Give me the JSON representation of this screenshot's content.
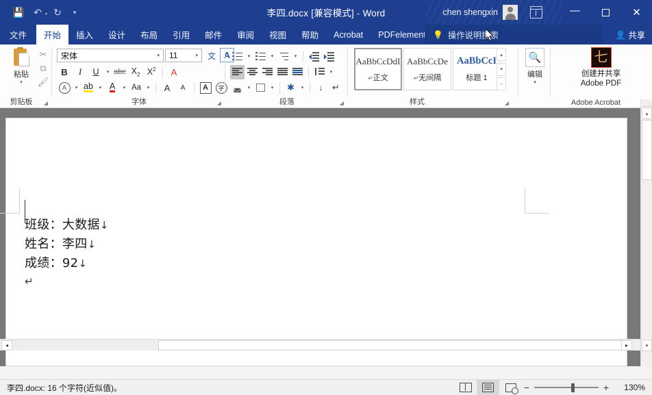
{
  "titlebar": {
    "quick_access": [
      {
        "name": "save-icon",
        "glyph": "💾"
      },
      {
        "name": "undo-icon",
        "glyph": "↶"
      },
      {
        "name": "redo-icon",
        "glyph": "↻"
      },
      {
        "name": "customize-qat-icon",
        "glyph": "▾"
      }
    ],
    "document_name": "李四.docx [兼容模式]",
    "separator": " - ",
    "app_name": "Word",
    "account_name": "chen shengxin",
    "window_buttons": {
      "minimize": "—",
      "maximize": "□",
      "close": "✕"
    }
  },
  "tabs": [
    {
      "label": "文件",
      "active": false
    },
    {
      "label": "开始",
      "active": true
    },
    {
      "label": "插入",
      "active": false
    },
    {
      "label": "设计",
      "active": false
    },
    {
      "label": "布局",
      "active": false
    },
    {
      "label": "引用",
      "active": false
    },
    {
      "label": "邮件",
      "active": false
    },
    {
      "label": "审阅",
      "active": false
    },
    {
      "label": "视图",
      "active": false
    },
    {
      "label": "帮助",
      "active": false
    },
    {
      "label": "Acrobat",
      "active": false
    },
    {
      "label": "PDFelement",
      "active": false
    }
  ],
  "tellme": {
    "label": "操作说明搜索",
    "icon": "lightbulb-icon"
  },
  "share": {
    "label": "共享",
    "icon": "share-person-icon"
  },
  "ribbon": {
    "clipboard": {
      "group_label": "剪贴板",
      "paste_label": "粘贴",
      "paste_caret": "▾",
      "cut": "✂",
      "copy": "⧉",
      "format_painter": "🖌"
    },
    "font": {
      "group_label": "字体",
      "font_name": "宋体",
      "font_size": "11",
      "caret": "▾",
      "bold": "B",
      "italic": "I",
      "underline": "U",
      "strikethrough": "abc",
      "subscript_base": "X",
      "subscript_sub": "2",
      "superscript_base": "X",
      "superscript_sup": "2",
      "clear_format": "A",
      "text_effects": "A",
      "highlight": "ab",
      "font_color": "A",
      "change_case": "Aa",
      "grow_font": "A",
      "shrink_font": "A",
      "char_border": "A",
      "phonetic": "字",
      "asian_layout": "文"
    },
    "paragraph": {
      "group_label": "段落",
      "bullets": "bullet-list-icon",
      "numbering": "numbered-list-icon",
      "multilevel": "multilevel-list-icon",
      "decrease_indent": "decrease-indent-icon",
      "increase_indent": "increase-indent-icon",
      "align_left": "align-left-icon",
      "align_center": "align-center-icon",
      "align_right": "align-right-icon",
      "justify": "justify-icon",
      "distribute": "distribute-icon",
      "line_spacing": "line-spacing-icon",
      "shading": "shading-icon",
      "borders": "borders-icon",
      "phonetic_guide": "phonetic-guide-icon",
      "sort": "sort-icon",
      "show_marks": "show-paragraph-marks-icon"
    },
    "styles": {
      "group_label": "样式",
      "items": [
        {
          "preview": "AaBbCcDdI",
          "name": "正文",
          "pilcrow": "↵",
          "selected": true,
          "blue": false
        },
        {
          "preview": "AaBbCcDе",
          "name": "无间隔",
          "pilcrow": "↵",
          "selected": false,
          "blue": false
        },
        {
          "preview": "AaBbCcI",
          "name": "标题 1",
          "pilcrow": "",
          "selected": false,
          "blue": true
        }
      ],
      "scroll_up": "▴",
      "scroll_down": "▾",
      "more": "⌵"
    },
    "editing": {
      "group_label": "",
      "label": "编辑",
      "icon": "search-icon",
      "caret": "▾"
    },
    "acrobat": {
      "group_label": "Adobe Acrobat",
      "button_line1": "创建并共享",
      "button_line2": "Adobe PDF",
      "icon": "adobe-pdf-icon"
    },
    "collapse": "∧"
  },
  "document": {
    "lines": [
      {
        "text": "班级：大数据",
        "mark": "↓"
      },
      {
        "text": "姓名：李四",
        "mark": "↓"
      },
      {
        "text": "成绩：92",
        "mark": "↓"
      }
    ],
    "end_mark": "↵"
  },
  "statusbar": {
    "text": "李四.docx: 16 个字符(近似值)。",
    "views": [
      {
        "name": "read-mode-view",
        "active": false
      },
      {
        "name": "print-layout-view",
        "active": true
      },
      {
        "name": "web-layout-view",
        "active": false
      }
    ],
    "zoom_out": "−",
    "zoom_in": "+",
    "zoom_value": "130%"
  },
  "scrollbars": {
    "v_up": "▴",
    "v_down": "▾",
    "h_left": "◂",
    "h_right": "▸",
    "ribbon_up": "∧"
  },
  "colors": {
    "title_blue": "#1e3f8f",
    "tab_active_bg": "#ffffff",
    "doc_gray": "#787878",
    "accent": "#2b579a"
  }
}
